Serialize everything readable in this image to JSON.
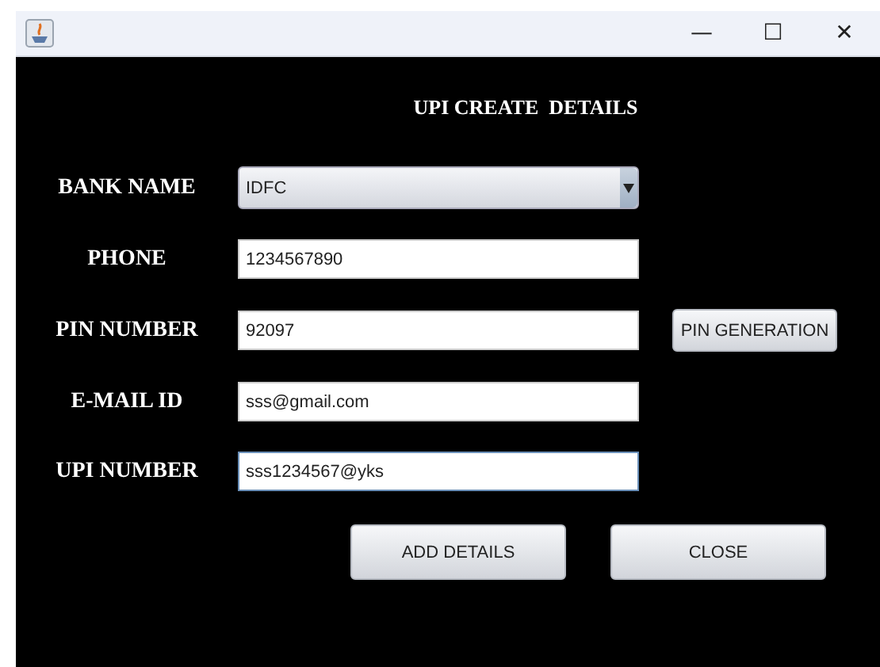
{
  "window": {
    "title_bar_buttons": [
      "—",
      "☐",
      "✕"
    ]
  },
  "heading": "UPI CREATE  DETAILS",
  "fields": [
    {
      "kind": "dropdown",
      "label": "BANK NAME",
      "value": "IDFC",
      "focused": false
    },
    {
      "kind": "text",
      "label": "PHONE",
      "value": "1234567890",
      "focused": false
    },
    {
      "kind": "text",
      "label": "PIN NUMBER",
      "value": "92097",
      "focused": false,
      "button": "PIN GENERATION"
    },
    {
      "kind": "text",
      "label": "E-MAIL ID",
      "value": "sss@gmail.com",
      "focused": false
    },
    {
      "kind": "text",
      "label": "UPI NUMBER",
      "value": "sss1234567@yks",
      "focused": true
    }
  ],
  "buttons": [
    "ADD DETAILS",
    "CLOSE"
  ]
}
